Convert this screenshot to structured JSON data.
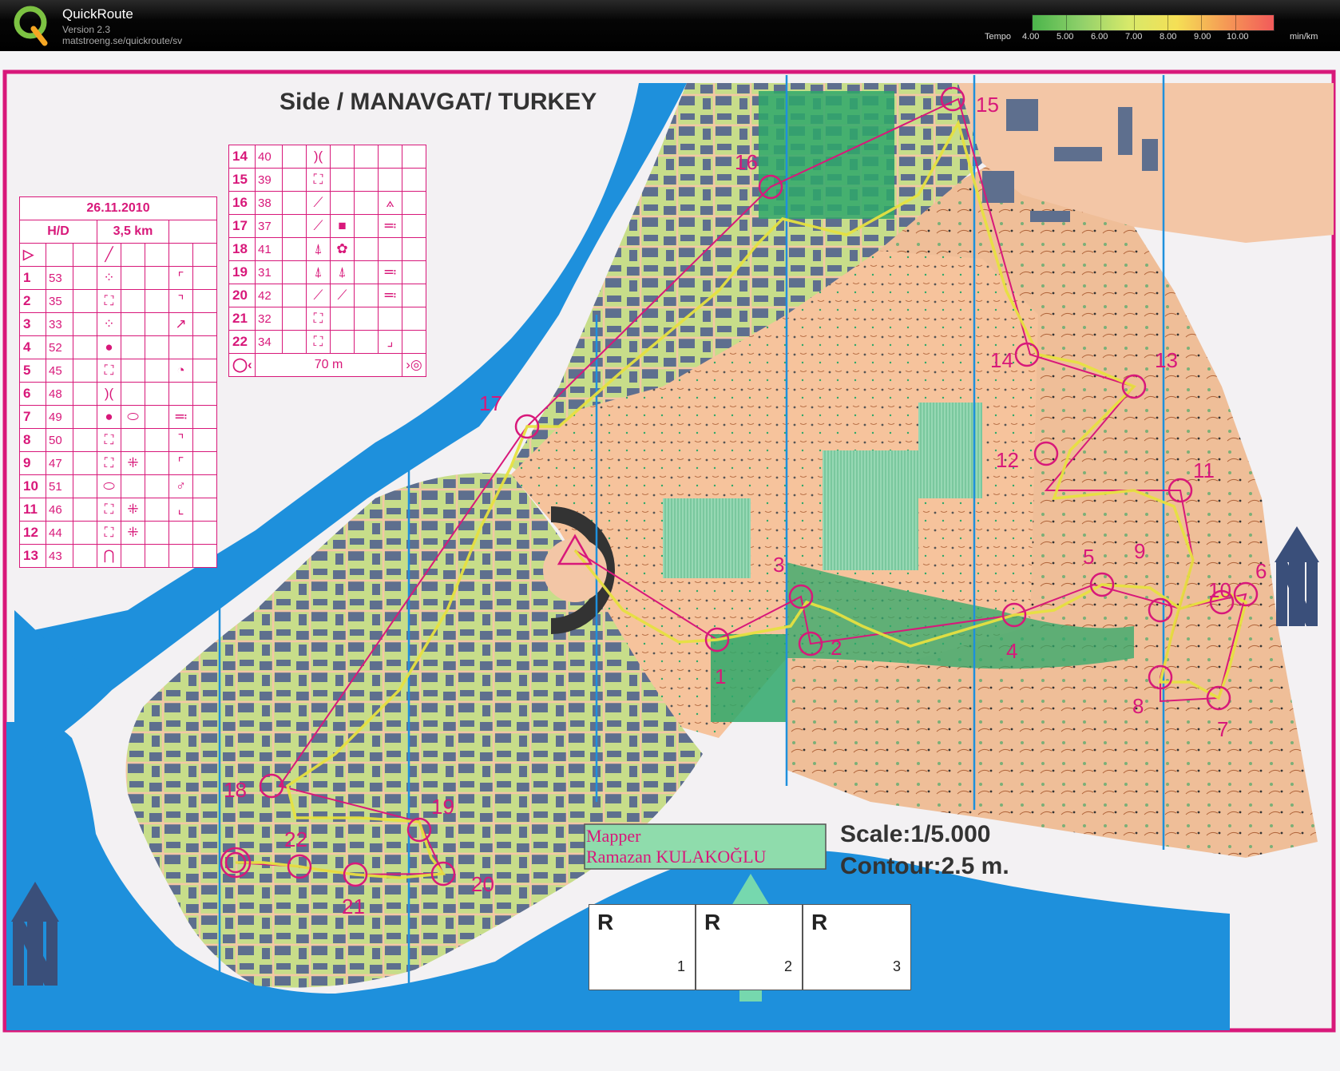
{
  "app": {
    "name": "QuickRoute",
    "version": "Version 2.3",
    "url": "matstroeng.se/quickroute/sv"
  },
  "tempo": {
    "label": "Tempo",
    "unit": "min/km",
    "ticks": [
      "4.00",
      "5.00",
      "6.00",
      "7.00",
      "8.00",
      "9.00",
      "10.00"
    ]
  },
  "map": {
    "title": "Side / MANAVGAT/ TURKEY",
    "date": "26.11.2010",
    "course": "H/D",
    "length": "3,5 km",
    "mapper_label": "Mapper",
    "mapper_name": "Ramazan KULAKOĞLU",
    "scale": "Scale:1/5.000",
    "contour": "Contour:2.5 m.",
    "finish_distance": "70 m",
    "r_letter": "R",
    "r_boxes": [
      "1",
      "2",
      "3"
    ],
    "controls_left": [
      {
        "n": "1",
        "code": "53"
      },
      {
        "n": "2",
        "code": "35"
      },
      {
        "n": "3",
        "code": "33"
      },
      {
        "n": "4",
        "code": "52"
      },
      {
        "n": "5",
        "code": "45"
      },
      {
        "n": "6",
        "code": "48"
      },
      {
        "n": "7",
        "code": "49"
      },
      {
        "n": "8",
        "code": "50"
      },
      {
        "n": "9",
        "code": "47"
      },
      {
        "n": "10",
        "code": "51"
      },
      {
        "n": "11",
        "code": "46"
      },
      {
        "n": "12",
        "code": "44"
      },
      {
        "n": "13",
        "code": "43"
      }
    ],
    "controls_right": [
      {
        "n": "14",
        "code": "40"
      },
      {
        "n": "15",
        "code": "39"
      },
      {
        "n": "16",
        "code": "38"
      },
      {
        "n": "17",
        "code": "37"
      },
      {
        "n": "18",
        "code": "41"
      },
      {
        "n": "19",
        "code": "31"
      },
      {
        "n": "20",
        "code": "42"
      },
      {
        "n": "21",
        "code": "32"
      },
      {
        "n": "22",
        "code": "34"
      }
    ],
    "control_labels": [
      "1",
      "2",
      "3",
      "4",
      "5",
      "6",
      "7",
      "8",
      "9",
      "10",
      "11",
      "12",
      "13",
      "14",
      "15",
      "16",
      "17",
      "18",
      "19",
      "20",
      "21",
      "22"
    ]
  },
  "colors": {
    "magenta": "#d8187a",
    "water": "#1e90dc",
    "green": "#b8d977",
    "forest": "#2ea86a",
    "open": "#f7c9a3",
    "building": "#5e6f8e",
    "route": "#e6e040"
  }
}
